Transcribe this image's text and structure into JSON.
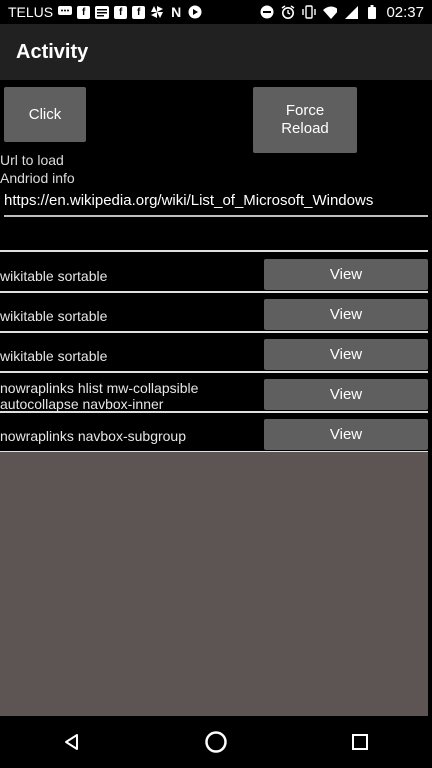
{
  "statusbar": {
    "carrier": "TELUS",
    "time": "02:37",
    "left_icons": [
      "chat-icon",
      "facebook-icon",
      "news-icon",
      "facebook-icon",
      "facebook-icon",
      "pinwheel-icon",
      "netflix-icon",
      "play-icon"
    ],
    "right_icons": [
      "dnd-icon",
      "alarm-icon",
      "vibrate-icon",
      "wifi-icon",
      "signal-icon",
      "battery-icon"
    ]
  },
  "appbar": {
    "title": "Activity"
  },
  "buttons": {
    "click": "Click",
    "force_reload_line1": "Force",
    "force_reload_line2": "Reload"
  },
  "labels": {
    "url_to_load": "Url to load",
    "android_info": "Andriod info"
  },
  "url_field": {
    "value": "https://en.wikipedia.org/wiki/List_of_Microsoft_Windows"
  },
  "rows": [
    {
      "text": "wikitable sortable",
      "button": "View"
    },
    {
      "text": "wikitable sortable",
      "button": "View"
    },
    {
      "text": "wikitable sortable",
      "button": "View"
    },
    {
      "text": "nowraplinks hlist mw-collapsible autocollapse navbox-inner",
      "button": "View"
    },
    {
      "text": "nowraplinks navbox-subgroup",
      "button": "View"
    }
  ],
  "colors": {
    "button": "#5f5f5f",
    "appbar": "#212121",
    "background": "#000000",
    "empty_area": "#5c5553"
  }
}
